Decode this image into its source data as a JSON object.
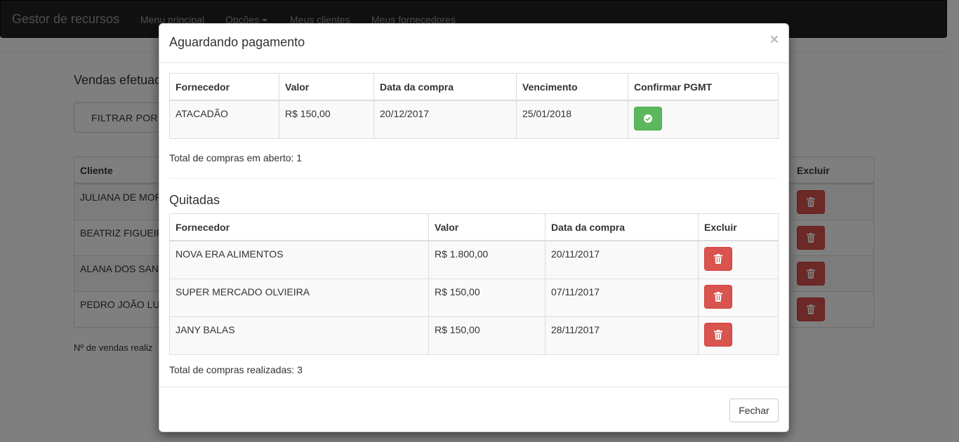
{
  "navbar": {
    "brand": "Gestor de recursos",
    "links": [
      "Menu principal",
      "Opções",
      "Meus clientes",
      "Meus fornecedores"
    ]
  },
  "background": {
    "title": "Vendas efetuadas",
    "filter_button": "FILTRAR POR",
    "table_headers": {
      "client": "Cliente",
      "delete": "Excluir"
    },
    "clients": [
      "JULIANA DE MOR",
      "BEATRIZ FIGUEIR",
      "ALANA DOS SAN",
      "PEDRO JOÃO LU"
    ],
    "footer": "Nº de vendas realiz"
  },
  "modal": {
    "title": "Aguardando pagamento",
    "close_glyph": "×",
    "pending": {
      "headers": [
        "Fornecedor",
        "Valor",
        "Data da compra",
        "Vencimento",
        "Confirmar PGMT"
      ],
      "rows": [
        {
          "supplier": "ATACADÃO",
          "value": "R$ 150,00",
          "date": "20/12/2017",
          "due": "25/01/2018"
        }
      ],
      "total": "Total de compras em aberto: 1"
    },
    "paid": {
      "title": "Quitadas",
      "headers": [
        "Fornecedor",
        "Valor",
        "Data da compra",
        "Excluir"
      ],
      "rows": [
        {
          "supplier": "NOVA ERA ALIMENTOS",
          "value": "R$ 1.800,00",
          "date": "20/11/2017"
        },
        {
          "supplier": "SUPER MERCADO OLVIEIRA",
          "value": "R$ 150,00",
          "date": "07/11/2017"
        },
        {
          "supplier": "JANY BALAS",
          "value": "R$ 150,00",
          "date": "28/11/2017"
        }
      ],
      "total": "Total de compras realizadas: 3"
    },
    "close_button": "Fechar"
  },
  "colors": {
    "success": "#5cb85c",
    "danger": "#d9534f",
    "navbar": "#222222"
  },
  "icons": {
    "confirm": "check-circle-icon",
    "delete": "trash-icon"
  }
}
